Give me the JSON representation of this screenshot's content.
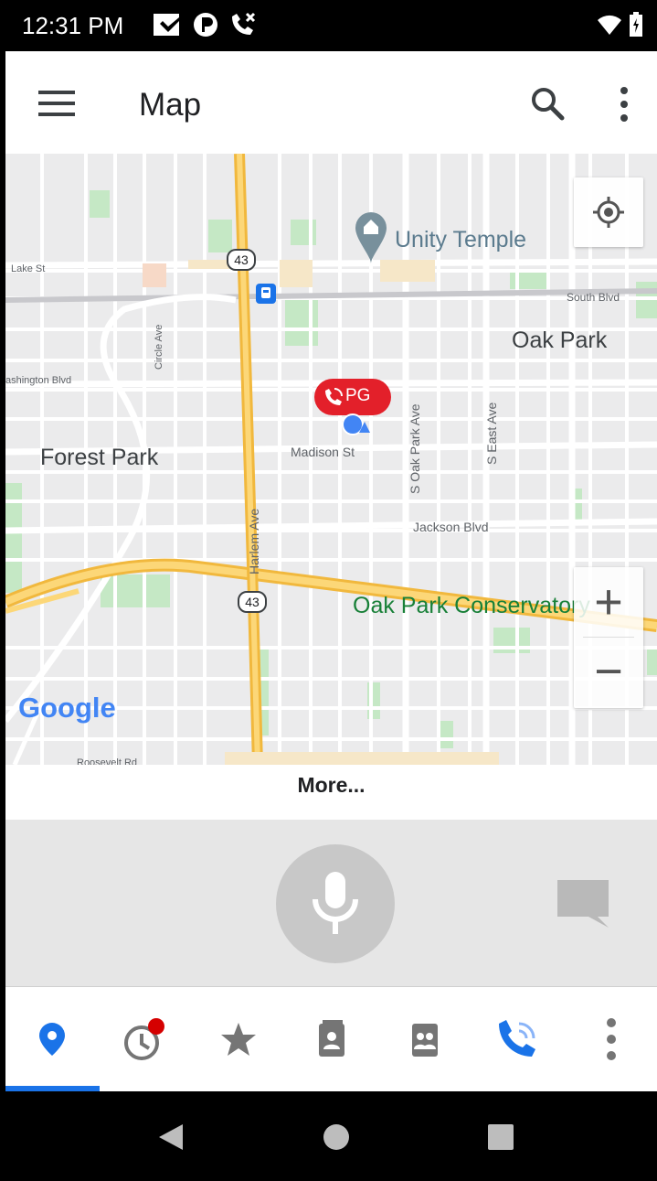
{
  "status_bar": {
    "time": "12:31 PM"
  },
  "app_bar": {
    "title": "Map"
  },
  "map": {
    "place_labels": {
      "unity_temple": "Unity Temple",
      "oak_park": "Oak Park",
      "forest_park": "Forest Park",
      "oak_park_conservatory": "Oak Park Conservatory"
    },
    "street_labels": {
      "lake_st": "Lake St",
      "south_blvd": "South Blvd",
      "washington_blvd": "ashington Blvd",
      "circle_ave": "Circle Ave",
      "madison_st": "Madison St",
      "s_oak_park_ave": "S Oak Park Ave",
      "s_east_ave": "S East Ave",
      "jackson_blvd": "Jackson Blvd",
      "harlem_ave": "Harlem Ave",
      "roosevelt_rd": "Roosevelt Rd"
    },
    "route_shields": [
      "43",
      "43"
    ],
    "marker_label": "PG",
    "logo": "Google",
    "zoom_in": "+",
    "zoom_out": "−"
  },
  "more_label": "More...",
  "bottom_nav": {
    "items": [
      {
        "icon": "location-pin-icon",
        "active": true
      },
      {
        "icon": "history-clock-icon",
        "badge": true
      },
      {
        "icon": "star-icon"
      },
      {
        "icon": "contact-card-icon"
      },
      {
        "icon": "group-contacts-icon"
      },
      {
        "icon": "ptt-call-icon"
      },
      {
        "icon": "more-vert-icon"
      }
    ]
  },
  "colors": {
    "accent": "#1a73e8",
    "marker_red": "#e3202a",
    "highway": "#f6c24a",
    "park": "#c5e8c5"
  }
}
